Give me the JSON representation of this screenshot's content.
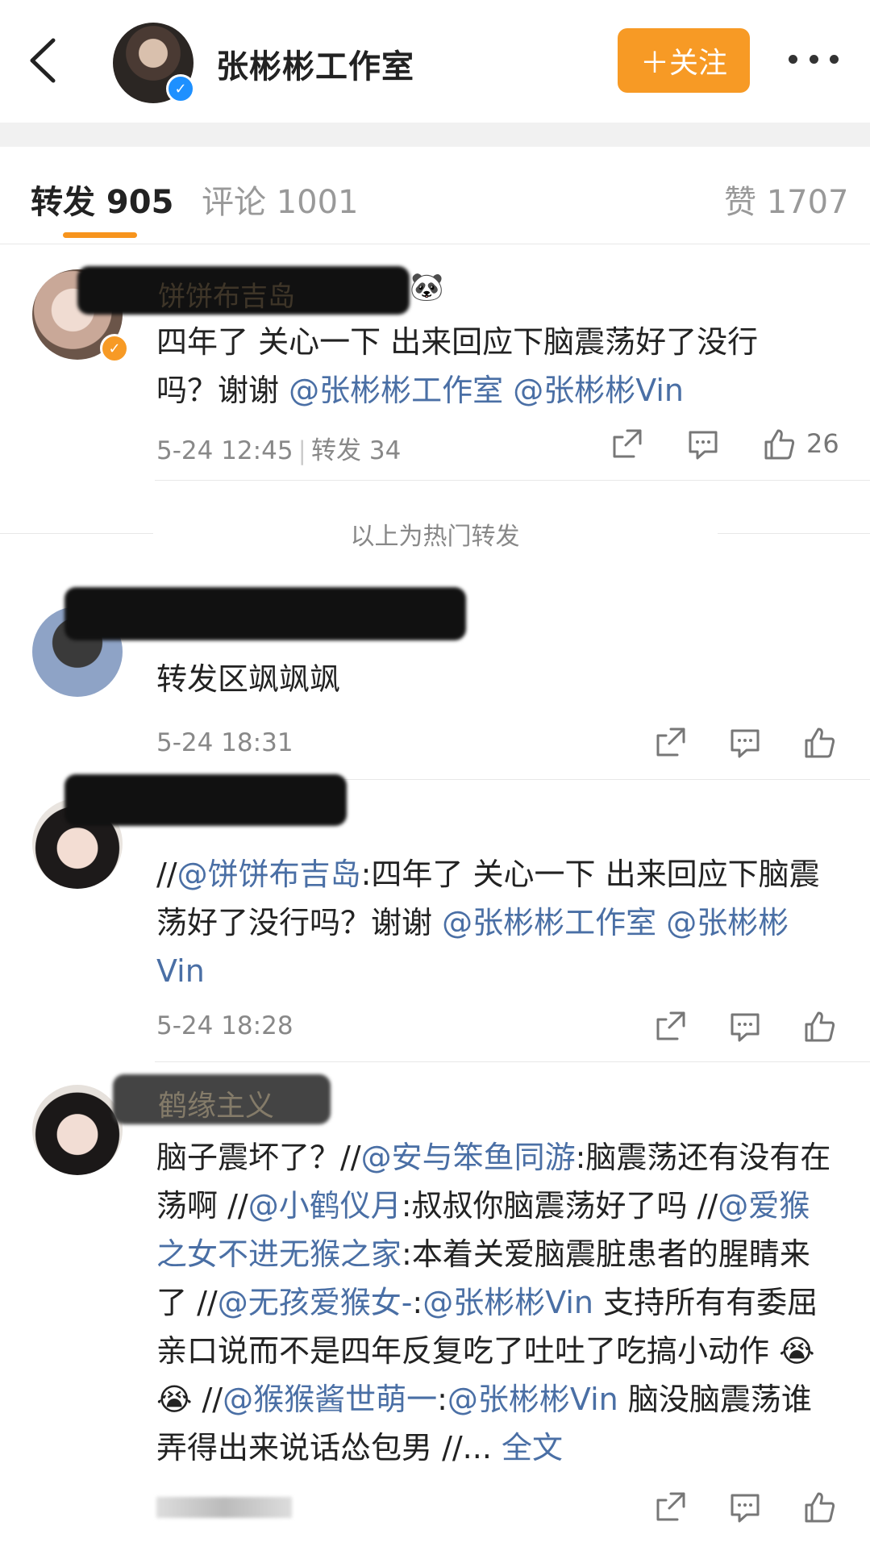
{
  "header": {
    "title": "张彬彬工作室",
    "follow_label": "＋关注"
  },
  "tabs": [
    {
      "label": "转发 905"
    },
    {
      "label": "评论 1001"
    },
    {
      "label": "赞 1707"
    }
  ],
  "posts": [
    {
      "body_text": "四年了 关心一下 出来回应下脑震荡好了没行吗？谢谢 ",
      "mention_1": "@张彬彬工作室",
      "mention_2": "@张彬彬Vin",
      "time": "5-24 12:45",
      "repost_count": "转发 34",
      "like_count": "26",
      "name_partial": "饼饼布吉岛"
    },
    {
      "body_text": "转发区飒飒飒",
      "time": "5-24 18:31"
    },
    {
      "prefix": "//",
      "mention_user": "@饼饼布吉岛",
      "quote_text": ":四年了 关心一下 出来回应下脑震荡好了没行吗？谢谢 ",
      "mention_1": "@张彬彬工作室",
      "mention_2": "@张彬彬Vin",
      "time": "5-24 18:28"
    },
    {
      "name_partial": "鹤缘主义",
      "seg1": "脑子震坏了？//",
      "m1": "@安与笨鱼同游",
      "seg2": ":脑震荡还有没有在荡啊 //",
      "m2": "@小鹤仪月",
      "seg3": ":叔叔你脑震荡好了吗 //",
      "m3": "@爱猴之女不进无猴之家",
      "seg4": ":本着关爱脑震脏患者的腥睛来了 //",
      "m4": "@无孩爱猴女-",
      "seg5": ":",
      "m5": "@张彬彬Vin",
      "seg6": " 支持所有有委屈亲口说而不是四年反复吃了吐吐了吃搞小动作 ",
      "seg7": " //",
      "m6": "@猴猴酱世萌一",
      "seg8": ":",
      "m7": "@张彬彬Vin",
      "seg9": " 脑没脑震荡谁弄得出来说话怂包男 //... ",
      "full_text": "全文"
    }
  ],
  "hot_divider": "以上为热门转发",
  "colors": {
    "accent": "#f79a25",
    "link": "#4a6fa5",
    "verified": "#1e90ff"
  },
  "icons": [
    "back-arrow-icon",
    "more-dots-icon",
    "share-icon",
    "comment-icon",
    "like-icon",
    "crying-emoji-icon",
    "panda-emoji-icon",
    "crown-icon"
  ]
}
